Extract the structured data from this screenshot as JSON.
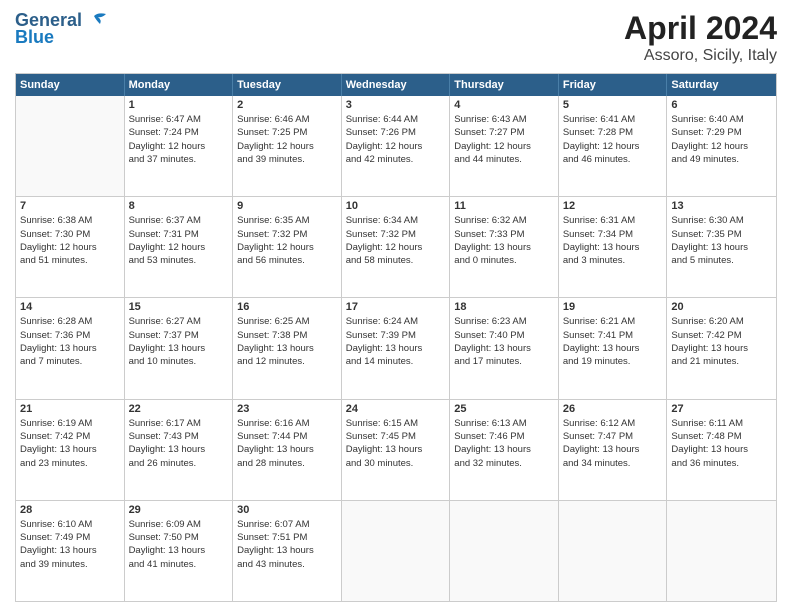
{
  "header": {
    "logo_general": "General",
    "logo_blue": "Blue",
    "title": "April 2024",
    "subtitle": "Assoro, Sicily, Italy"
  },
  "days": [
    "Sunday",
    "Monday",
    "Tuesday",
    "Wednesday",
    "Thursday",
    "Friday",
    "Saturday"
  ],
  "rows": [
    [
      {
        "day": "",
        "empty": true
      },
      {
        "day": "1",
        "lines": [
          "Sunrise: 6:47 AM",
          "Sunset: 7:24 PM",
          "Daylight: 12 hours",
          "and 37 minutes."
        ]
      },
      {
        "day": "2",
        "lines": [
          "Sunrise: 6:46 AM",
          "Sunset: 7:25 PM",
          "Daylight: 12 hours",
          "and 39 minutes."
        ]
      },
      {
        "day": "3",
        "lines": [
          "Sunrise: 6:44 AM",
          "Sunset: 7:26 PM",
          "Daylight: 12 hours",
          "and 42 minutes."
        ]
      },
      {
        "day": "4",
        "lines": [
          "Sunrise: 6:43 AM",
          "Sunset: 7:27 PM",
          "Daylight: 12 hours",
          "and 44 minutes."
        ]
      },
      {
        "day": "5",
        "lines": [
          "Sunrise: 6:41 AM",
          "Sunset: 7:28 PM",
          "Daylight: 12 hours",
          "and 46 minutes."
        ]
      },
      {
        "day": "6",
        "lines": [
          "Sunrise: 6:40 AM",
          "Sunset: 7:29 PM",
          "Daylight: 12 hours",
          "and 49 minutes."
        ]
      }
    ],
    [
      {
        "day": "7",
        "lines": [
          "Sunrise: 6:38 AM",
          "Sunset: 7:30 PM",
          "Daylight: 12 hours",
          "and 51 minutes."
        ]
      },
      {
        "day": "8",
        "lines": [
          "Sunrise: 6:37 AM",
          "Sunset: 7:31 PM",
          "Daylight: 12 hours",
          "and 53 minutes."
        ]
      },
      {
        "day": "9",
        "lines": [
          "Sunrise: 6:35 AM",
          "Sunset: 7:32 PM",
          "Daylight: 12 hours",
          "and 56 minutes."
        ]
      },
      {
        "day": "10",
        "lines": [
          "Sunrise: 6:34 AM",
          "Sunset: 7:32 PM",
          "Daylight: 12 hours",
          "and 58 minutes."
        ]
      },
      {
        "day": "11",
        "lines": [
          "Sunrise: 6:32 AM",
          "Sunset: 7:33 PM",
          "Daylight: 13 hours",
          "and 0 minutes."
        ]
      },
      {
        "day": "12",
        "lines": [
          "Sunrise: 6:31 AM",
          "Sunset: 7:34 PM",
          "Daylight: 13 hours",
          "and 3 minutes."
        ]
      },
      {
        "day": "13",
        "lines": [
          "Sunrise: 6:30 AM",
          "Sunset: 7:35 PM",
          "Daylight: 13 hours",
          "and 5 minutes."
        ]
      }
    ],
    [
      {
        "day": "14",
        "lines": [
          "Sunrise: 6:28 AM",
          "Sunset: 7:36 PM",
          "Daylight: 13 hours",
          "and 7 minutes."
        ]
      },
      {
        "day": "15",
        "lines": [
          "Sunrise: 6:27 AM",
          "Sunset: 7:37 PM",
          "Daylight: 13 hours",
          "and 10 minutes."
        ]
      },
      {
        "day": "16",
        "lines": [
          "Sunrise: 6:25 AM",
          "Sunset: 7:38 PM",
          "Daylight: 13 hours",
          "and 12 minutes."
        ]
      },
      {
        "day": "17",
        "lines": [
          "Sunrise: 6:24 AM",
          "Sunset: 7:39 PM",
          "Daylight: 13 hours",
          "and 14 minutes."
        ]
      },
      {
        "day": "18",
        "lines": [
          "Sunrise: 6:23 AM",
          "Sunset: 7:40 PM",
          "Daylight: 13 hours",
          "and 17 minutes."
        ]
      },
      {
        "day": "19",
        "lines": [
          "Sunrise: 6:21 AM",
          "Sunset: 7:41 PM",
          "Daylight: 13 hours",
          "and 19 minutes."
        ]
      },
      {
        "day": "20",
        "lines": [
          "Sunrise: 6:20 AM",
          "Sunset: 7:42 PM",
          "Daylight: 13 hours",
          "and 21 minutes."
        ]
      }
    ],
    [
      {
        "day": "21",
        "lines": [
          "Sunrise: 6:19 AM",
          "Sunset: 7:42 PM",
          "Daylight: 13 hours",
          "and 23 minutes."
        ]
      },
      {
        "day": "22",
        "lines": [
          "Sunrise: 6:17 AM",
          "Sunset: 7:43 PM",
          "Daylight: 13 hours",
          "and 26 minutes."
        ]
      },
      {
        "day": "23",
        "lines": [
          "Sunrise: 6:16 AM",
          "Sunset: 7:44 PM",
          "Daylight: 13 hours",
          "and 28 minutes."
        ]
      },
      {
        "day": "24",
        "lines": [
          "Sunrise: 6:15 AM",
          "Sunset: 7:45 PM",
          "Daylight: 13 hours",
          "and 30 minutes."
        ]
      },
      {
        "day": "25",
        "lines": [
          "Sunrise: 6:13 AM",
          "Sunset: 7:46 PM",
          "Daylight: 13 hours",
          "and 32 minutes."
        ]
      },
      {
        "day": "26",
        "lines": [
          "Sunrise: 6:12 AM",
          "Sunset: 7:47 PM",
          "Daylight: 13 hours",
          "and 34 minutes."
        ]
      },
      {
        "day": "27",
        "lines": [
          "Sunrise: 6:11 AM",
          "Sunset: 7:48 PM",
          "Daylight: 13 hours",
          "and 36 minutes."
        ]
      }
    ],
    [
      {
        "day": "28",
        "lines": [
          "Sunrise: 6:10 AM",
          "Sunset: 7:49 PM",
          "Daylight: 13 hours",
          "and 39 minutes."
        ]
      },
      {
        "day": "29",
        "lines": [
          "Sunrise: 6:09 AM",
          "Sunset: 7:50 PM",
          "Daylight: 13 hours",
          "and 41 minutes."
        ]
      },
      {
        "day": "30",
        "lines": [
          "Sunrise: 6:07 AM",
          "Sunset: 7:51 PM",
          "Daylight: 13 hours",
          "and 43 minutes."
        ]
      },
      {
        "day": "",
        "empty": true
      },
      {
        "day": "",
        "empty": true
      },
      {
        "day": "",
        "empty": true
      },
      {
        "day": "",
        "empty": true
      }
    ]
  ]
}
